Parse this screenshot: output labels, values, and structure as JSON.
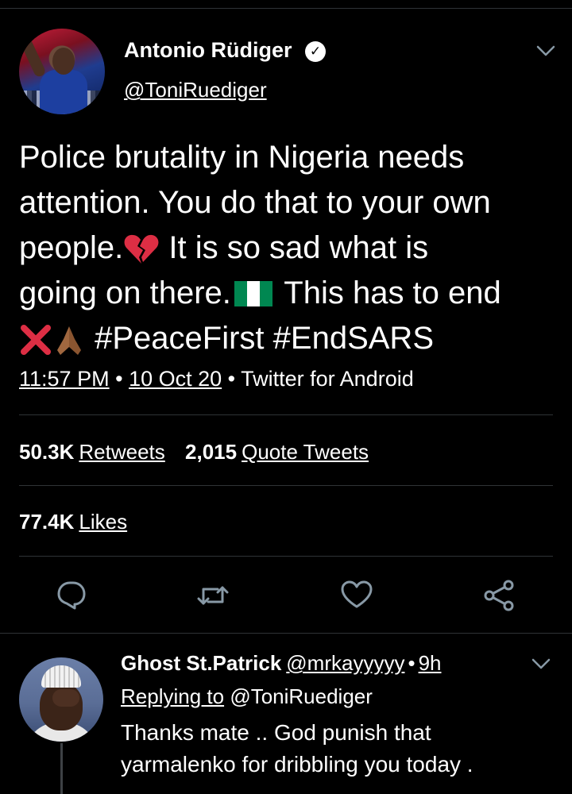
{
  "tweet": {
    "author_name": "Antonio Rüdiger",
    "author_handle": "@ToniRuediger",
    "text_lines": [
      "Police brutality in Nigeria needs",
      "attention. You do that to your own",
      "people.",
      " It is so sad what is",
      "going on there.",
      " This has to end",
      "#PeaceFirst #EndSARS"
    ],
    "time": "11:57 PM",
    "date": "10 Oct 20",
    "source": "Twitter for Android",
    "dot": "•",
    "retweets_count": "50.3K",
    "retweets_label": "Retweets",
    "quote_count": "2,015",
    "quote_label": "Quote Tweets",
    "likes_count": "77.4K",
    "likes_label": "Likes",
    "icons": {
      "verified": "verified-badge-icon",
      "menu": "chevron-down-icon",
      "reply": "comment-icon",
      "retweet": "retweet-icon",
      "like": "heart-icon",
      "share": "share-icon",
      "emoji_broken_heart": "broken-heart-emoji",
      "emoji_flag": "nigeria-flag-emoji",
      "emoji_x": "cross-mark-emoji",
      "emoji_pray": "folded-hands-emoji"
    }
  },
  "reply": {
    "author_name": "Ghost St.Patrick",
    "author_handle": "@mrkayyyyy",
    "dot": "•",
    "time": "9h",
    "replying_prefix": "Replying to",
    "replying_handle": "@ToniRuediger",
    "text": "Thanks mate .. God punish that yarmalenko for dribbling you today ."
  },
  "colors": {
    "background": "#000000",
    "text": "#ffffff",
    "divider": "#2f3336",
    "icon": "#8899a6",
    "flag_green": "#008751",
    "flag_white": "#ffffff",
    "cross_red": "#dd2e44",
    "broken_heart": "#dd2e44"
  }
}
